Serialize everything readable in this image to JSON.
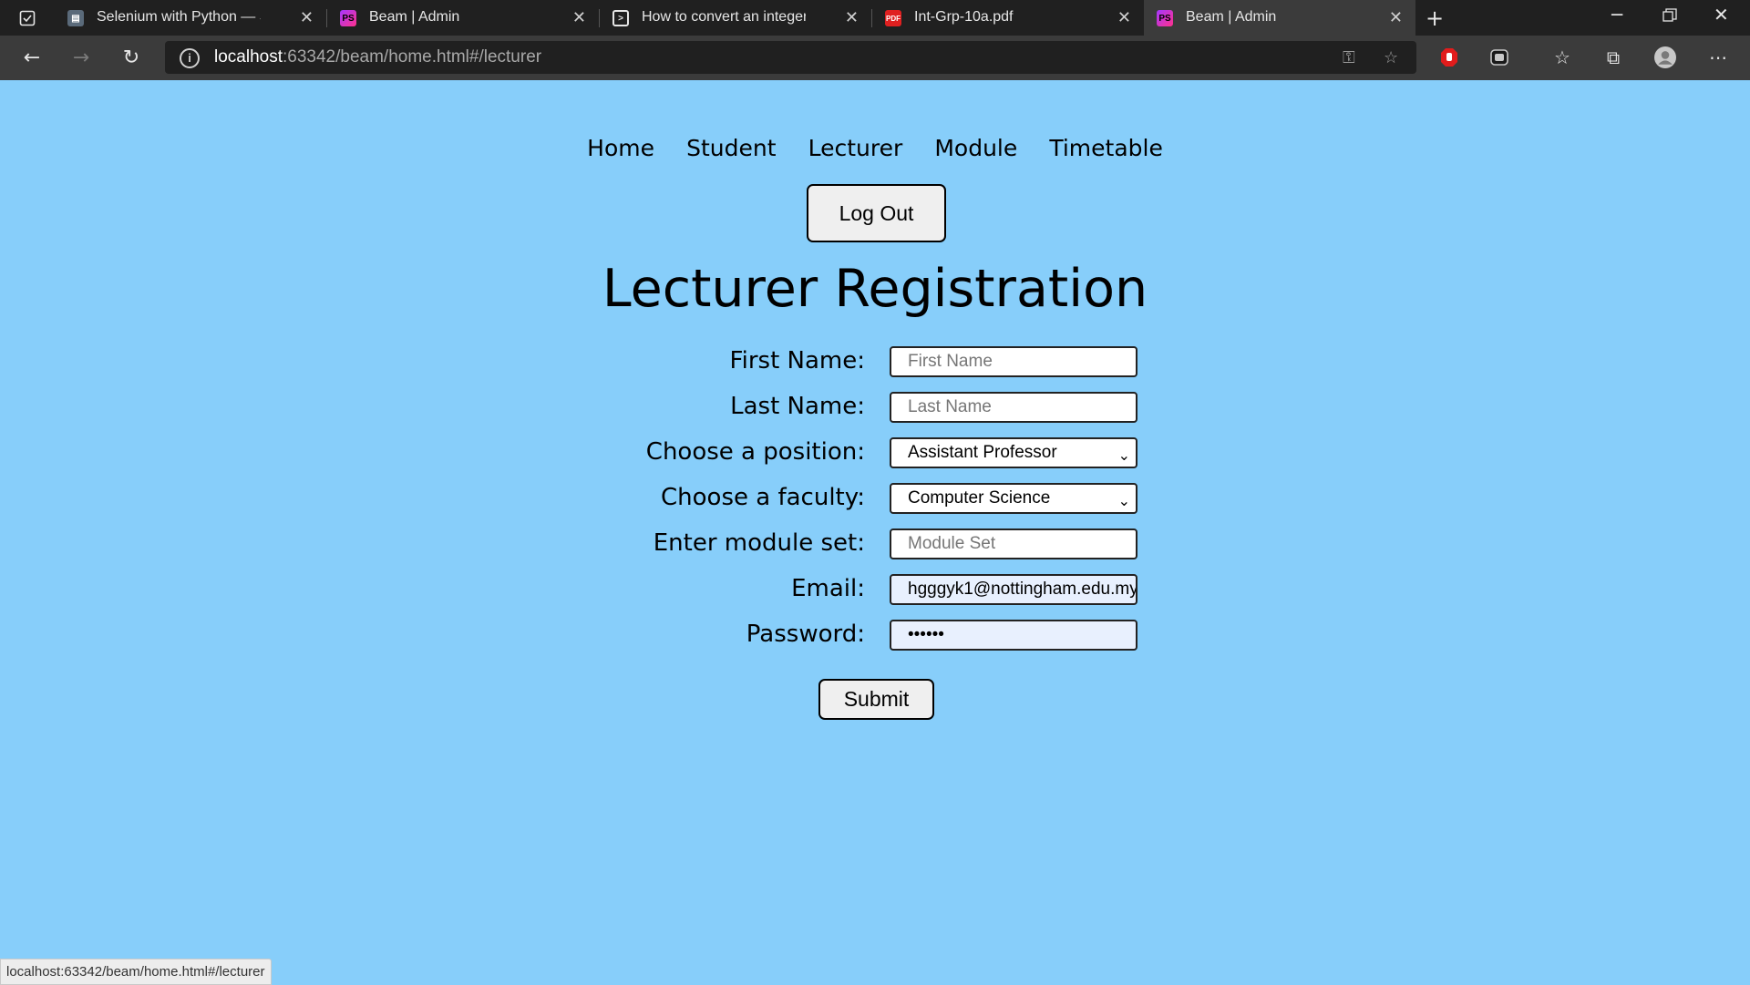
{
  "browser": {
    "tabs": [
      {
        "title": "Selenium with Python — Seleniu",
        "favicon": "book-icon",
        "active": false
      },
      {
        "title": "Beam | Admin",
        "favicon": "phpstorm-icon",
        "active": false
      },
      {
        "title": "How to convert an integer to a st",
        "favicon": "terminal-icon",
        "active": false
      },
      {
        "title": "Int-Grp-10a.pdf",
        "favicon": "pdf-icon",
        "active": false
      },
      {
        "title": "Beam | Admin",
        "favicon": "phpstorm-icon",
        "active": true
      }
    ],
    "address": {
      "host": "localhost",
      "path": ":63342/beam/home.html#/lecturer"
    }
  },
  "nav": {
    "home": "Home",
    "student": "Student",
    "lecturer": "Lecturer",
    "module": "Module",
    "timetable": "Timetable"
  },
  "logout_label": "Log Out",
  "page_title": "Lecturer Registration",
  "form": {
    "first_name": {
      "label": "First Name:",
      "placeholder": "First Name",
      "value": ""
    },
    "last_name": {
      "label": "Last Name:",
      "placeholder": "Last Name",
      "value": ""
    },
    "position": {
      "label": "Choose a position:",
      "selected": "Assistant Professor"
    },
    "faculty": {
      "label": "Choose a faculty:",
      "selected": "Computer Science"
    },
    "module_set": {
      "label": "Enter module set:",
      "placeholder": "Module Set",
      "value": ""
    },
    "email": {
      "label": "Email:",
      "value": "hgggyk1@nottingham.edu.my"
    },
    "password": {
      "label": "Password:",
      "value": "••••••"
    },
    "submit_label": "Submit"
  },
  "status_url": "localhost:63342/beam/home.html#/lecturer",
  "colors": {
    "page_bg": "#87cefa",
    "chrome_dark": "#202020",
    "chrome_toolbar": "#3b3b3b",
    "autofill": "#e8f0fe"
  }
}
